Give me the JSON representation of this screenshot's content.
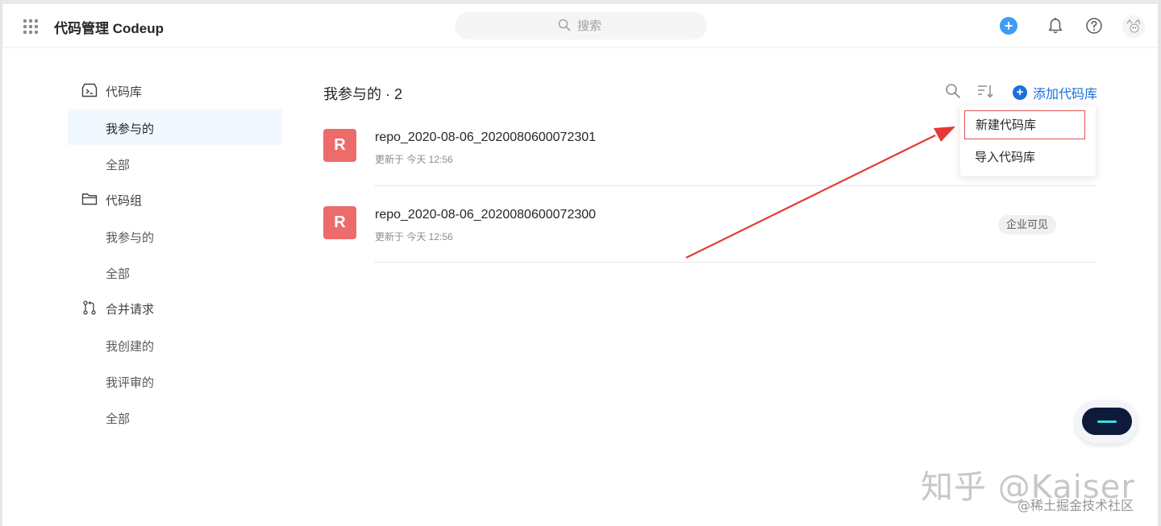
{
  "header": {
    "app_title": "代码管理 Codeup",
    "search_placeholder": "搜索"
  },
  "sidebar": {
    "groups": [
      {
        "label": "代码库",
        "icon": "terminal-icon",
        "items": [
          "我参与的",
          "全部"
        ]
      },
      {
        "label": "代码组",
        "icon": "folder-icon",
        "items": [
          "我参与的",
          "全部"
        ]
      },
      {
        "label": "合并请求",
        "icon": "merge-request-icon",
        "items": [
          "我创建的",
          "我评审的",
          "全部"
        ]
      }
    ],
    "active_item": "我参与的"
  },
  "main": {
    "title": "我参与的 · 2",
    "add_repo_label": "添加代码库",
    "repos": [
      {
        "avatar_letter": "R",
        "name": "repo_2020-08-06_2020080600072301",
        "updated": "更新于 今天 12:56",
        "visibility": ""
      },
      {
        "avatar_letter": "R",
        "name": "repo_2020-08-06_2020080600072300",
        "updated": "更新于 今天 12:56",
        "visibility": "企业可见"
      }
    ]
  },
  "dropdown": {
    "items": [
      "新建代码库",
      "导入代码库"
    ]
  },
  "watermark": {
    "line1": "知乎 @Kaiser",
    "line2": "@稀土掘金技术社区"
  },
  "colors": {
    "accent": "#1b6fe0",
    "avatar_bg": "#ee6b6b",
    "highlight_border": "#e0524e",
    "annotation_arrow": "#e53935",
    "active_bg": "#f2f8ff"
  }
}
